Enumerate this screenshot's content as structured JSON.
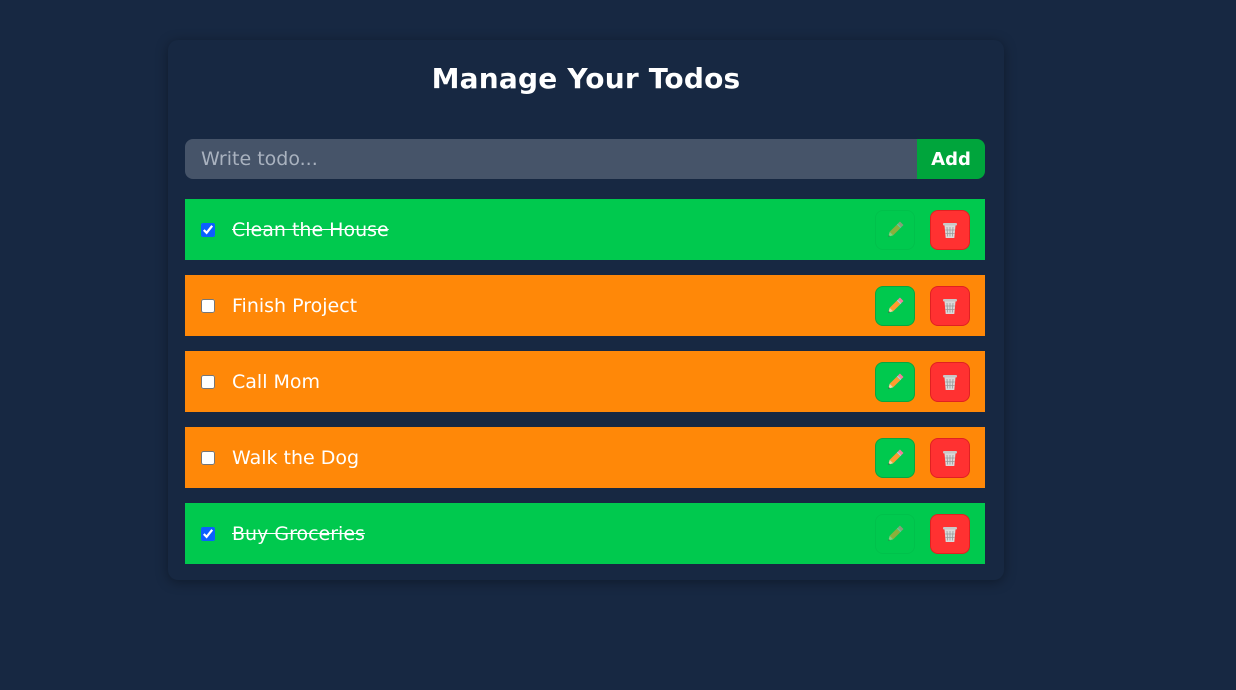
{
  "app": {
    "title": "Manage Your Todos"
  },
  "form": {
    "placeholder": "Write todo...",
    "value": "",
    "add_label": "Add"
  },
  "todos": [
    {
      "text": "Clean the House",
      "completed": true
    },
    {
      "text": "Finish Project",
      "completed": false
    },
    {
      "text": "Call Mom",
      "completed": false
    },
    {
      "text": "Walk the Dog",
      "completed": false
    },
    {
      "text": "Buy Groceries",
      "completed": true
    }
  ],
  "icons": {
    "edit": "pencil-icon",
    "delete": "wastebasket-icon"
  },
  "colors": {
    "background": "#172842",
    "completed": "#00c94e",
    "pending": "#ff8808",
    "add_button": "#00a53c",
    "delete_button": "#ff3131",
    "input": "#465469"
  }
}
